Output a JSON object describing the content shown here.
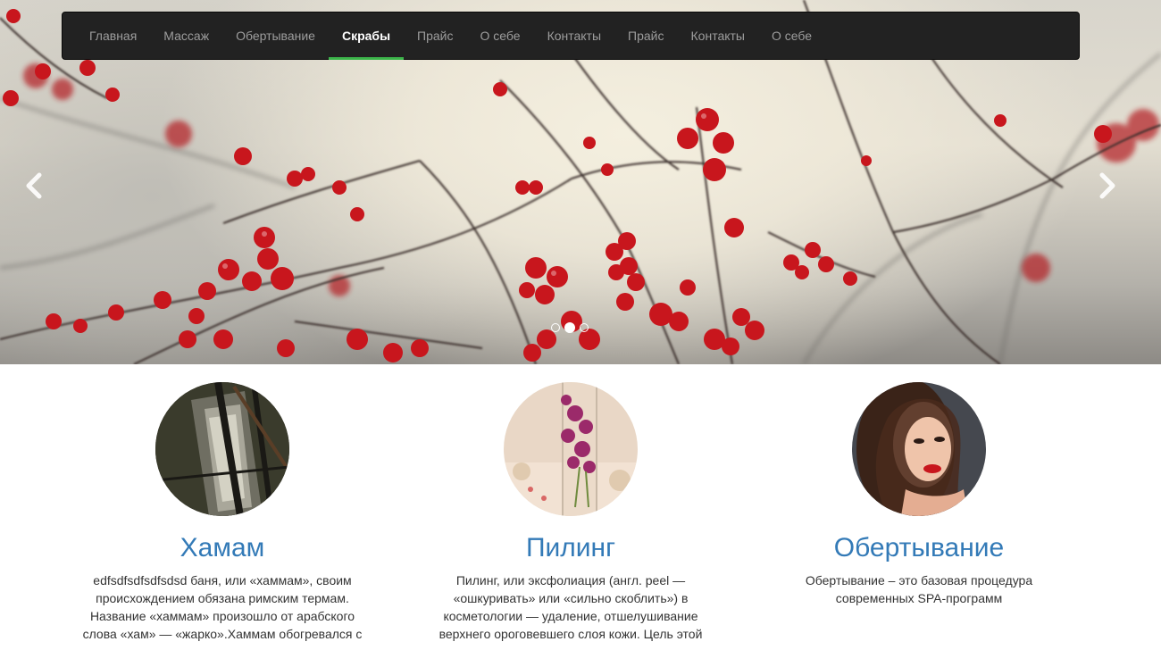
{
  "navbar": {
    "items": [
      {
        "label": "Главная"
      },
      {
        "label": "Массаж"
      },
      {
        "label": "Обертывание"
      },
      {
        "label": "Скрабы",
        "active": true
      },
      {
        "label": "Прайс"
      },
      {
        "label": "О себе"
      },
      {
        "label": "Контакты"
      },
      {
        "label": "Прайс"
      },
      {
        "label": "Контакты"
      },
      {
        "label": "О себе"
      }
    ],
    "active_underline_color": "#3cb54a"
  },
  "carousel": {
    "prev_icon": "chevron-left-icon",
    "next_icon": "chevron-right-icon",
    "slides_count": 3,
    "active_slide": 2
  },
  "features": [
    {
      "title": "Хамам",
      "text": "edfsdfsdfsdfsdsd баня, или «хаммам», своим происхождением обязана римским термам. Название «хаммам» произошло от арабского слова «хам» — «жарко».Хаммам обогревался с"
    },
    {
      "title": "Пилинг",
      "text": "Пилинг, или эксфолиация (англ. peel — «ошкуривать» или «сильно скоблить») в косметологии — удаление, отшелушивание верхнего ороговевшего слоя кожи. Цель этой"
    },
    {
      "title": "Обертывание",
      "text": "Обертывание – это базовая процедура современных SPA-программ"
    }
  ],
  "colors": {
    "navbar_bg": "#222222",
    "heading_blue": "#337ab7",
    "berry_red": "#c8161d"
  }
}
